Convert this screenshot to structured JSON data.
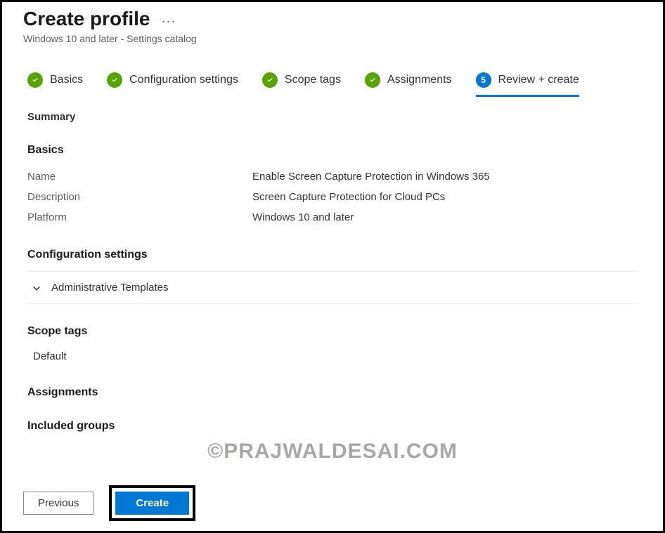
{
  "header": {
    "title": "Create profile",
    "subtitle": "Windows 10 and later - Settings catalog"
  },
  "steps": [
    {
      "label": "Basics",
      "state": "done"
    },
    {
      "label": "Configuration settings",
      "state": "done"
    },
    {
      "label": "Scope tags",
      "state": "done"
    },
    {
      "label": "Assignments",
      "state": "done"
    },
    {
      "label": "Review + create",
      "state": "active",
      "number": "5"
    }
  ],
  "summary": {
    "heading": "Summary",
    "basics": {
      "heading": "Basics",
      "rows": {
        "name_label": "Name",
        "name_value": "Enable Screen Capture Protection in Windows 365",
        "description_label": "Description",
        "description_value": "Screen Capture Protection for Cloud PCs",
        "platform_label": "Platform",
        "platform_value": "Windows 10 and later"
      }
    },
    "config": {
      "heading": "Configuration settings",
      "expander_label": "Administrative Templates"
    },
    "scope": {
      "heading": "Scope tags",
      "value": "Default"
    },
    "assignments": {
      "heading": "Assignments"
    },
    "included_groups": {
      "heading": "Included groups"
    }
  },
  "footer": {
    "previous": "Previous",
    "create": "Create"
  },
  "watermark": "©PRAJWALDESAI.COM"
}
